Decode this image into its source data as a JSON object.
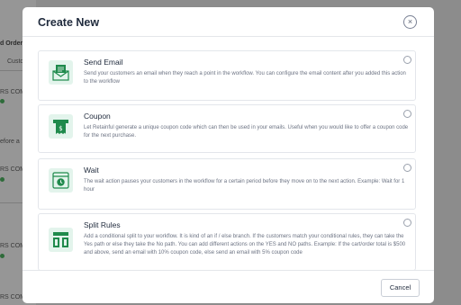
{
  "background": {
    "frag_orders": "d Order",
    "frag_custom": "Custo",
    "frag_rs_comm_1": "RS COMM",
    "frag_before": "efore a",
    "frag_rs_comm_2": "RS COMM",
    "frag_rs_comm_3": "RS COMM",
    "frag_rs_comm_4": "RS COMM"
  },
  "modal": {
    "title": "Create New",
    "close_label": "×",
    "options": [
      {
        "title": "Send Email",
        "description": "Send your customers an email when they reach a point in the workflow. You can configure the email content after you added this action to the workflow",
        "icon": "email-icon"
      },
      {
        "title": "Coupon",
        "description": "Let Retainful generate a unique coupon code which can then be used in your emails. Useful when you would like to offer a coupon code for the next purchase.",
        "icon": "coupon-icon"
      },
      {
        "title": "Wait",
        "description": "The wait action pauses your customers in the workflow for a certain period before they move on to the next action. Example: Wait for 1 hour",
        "icon": "wait-icon"
      },
      {
        "title": "Split Rules",
        "description": "Add a conditional split to your workflow. It is kind of an if / else branch. If the customers match your conditional rules, they can take the Yes path or else they take the No path. You can add different actions on the YES and NO paths. Example: If the cart/order total is $500 and above, send an email with 10% coupon code, else send an email with 5% coupon code",
        "icon": "split-icon"
      }
    ],
    "cancel_label": "Cancel"
  },
  "colors": {
    "icon_green": "#1f8a4c",
    "icon_bg": "#e3f4ec",
    "title_text": "#1f2a3c",
    "desc_text": "#6c7383"
  }
}
